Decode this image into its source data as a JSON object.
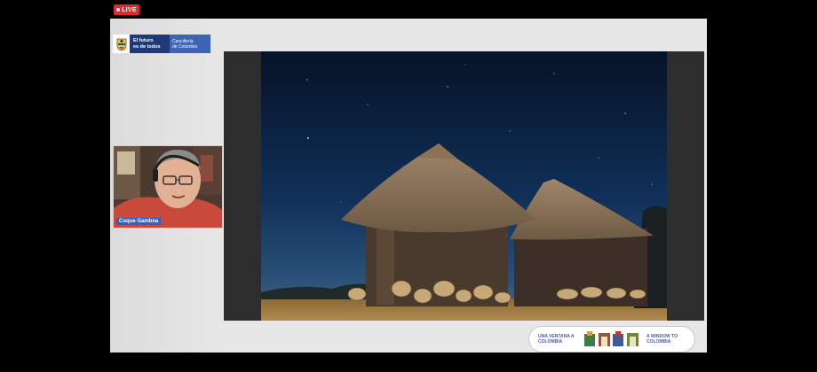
{
  "live": {
    "label": "LIVE"
  },
  "logo": {
    "slogan_line1": "El futuro",
    "slogan_line2": "es de todos",
    "ministry_line1": "Cancillería",
    "ministry_line2": "de Colombia"
  },
  "speaker": {
    "name": "Coque Gamboa"
  },
  "banner": {
    "es_line1": "UNA VENTANA A",
    "es_line2": "COLOMBIA",
    "en_line1": "A WINDOW TO",
    "en_line2": "COLOMBIA"
  },
  "colors": {
    "live": "#e02a2a",
    "brand_dark": "#1e3a7d",
    "brand_light": "#3e65b5",
    "name_tag": "#2b62c9"
  }
}
